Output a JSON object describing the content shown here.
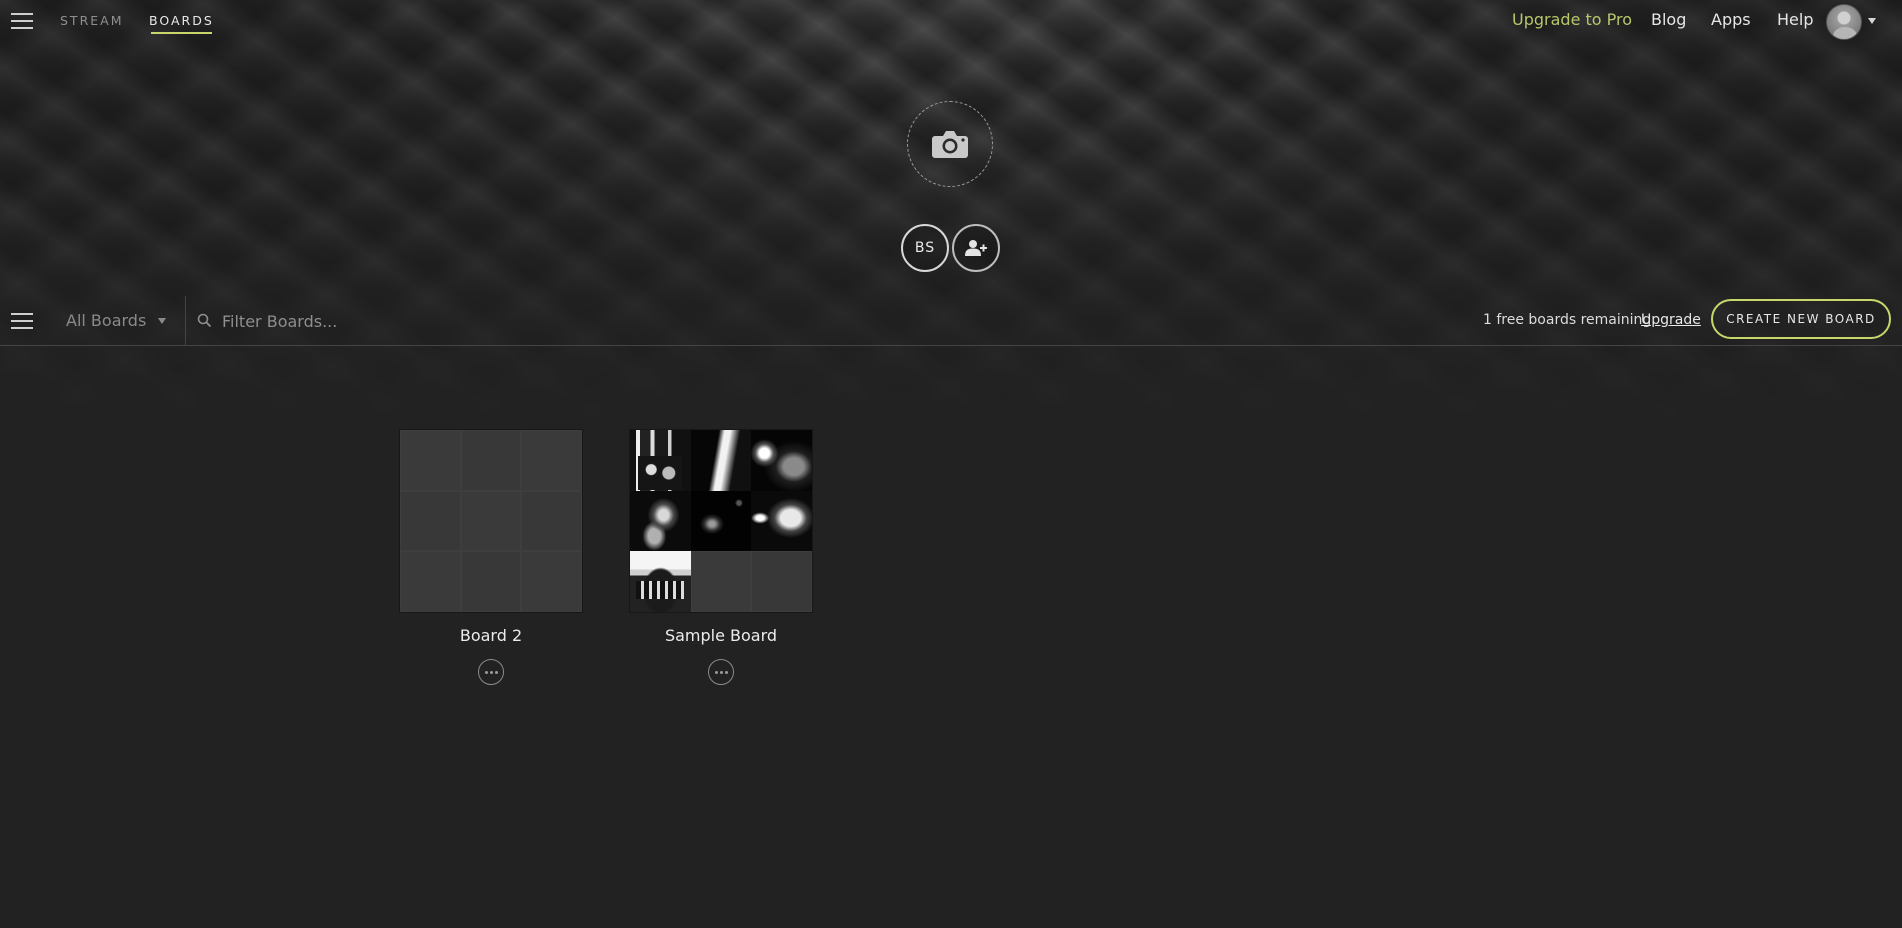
{
  "topnav": {
    "tabs": [
      {
        "label": "STREAM",
        "active": false
      },
      {
        "label": "BOARDS",
        "active": true
      }
    ],
    "links": {
      "upgrade_pro": "Upgrade to Pro",
      "blog": "Blog",
      "apps": "Apps",
      "help": "Help"
    },
    "accent_color": "#c8d66b"
  },
  "hero": {
    "members": [
      {
        "initials": "BS"
      }
    ],
    "icons": [
      "camera-icon",
      "add-user-icon"
    ]
  },
  "toolbar": {
    "board_filter_selected": "All Boards",
    "filter_placeholder": "Filter Boards...",
    "remaining_text": "1 free boards remaining.",
    "upgrade_label": "Upgrade",
    "create_button_label": "CREATE NEW BOARD"
  },
  "boards": [
    {
      "name": "Board 2",
      "image_count": 0
    },
    {
      "name": "Sample Board",
      "image_count": 7
    }
  ]
}
